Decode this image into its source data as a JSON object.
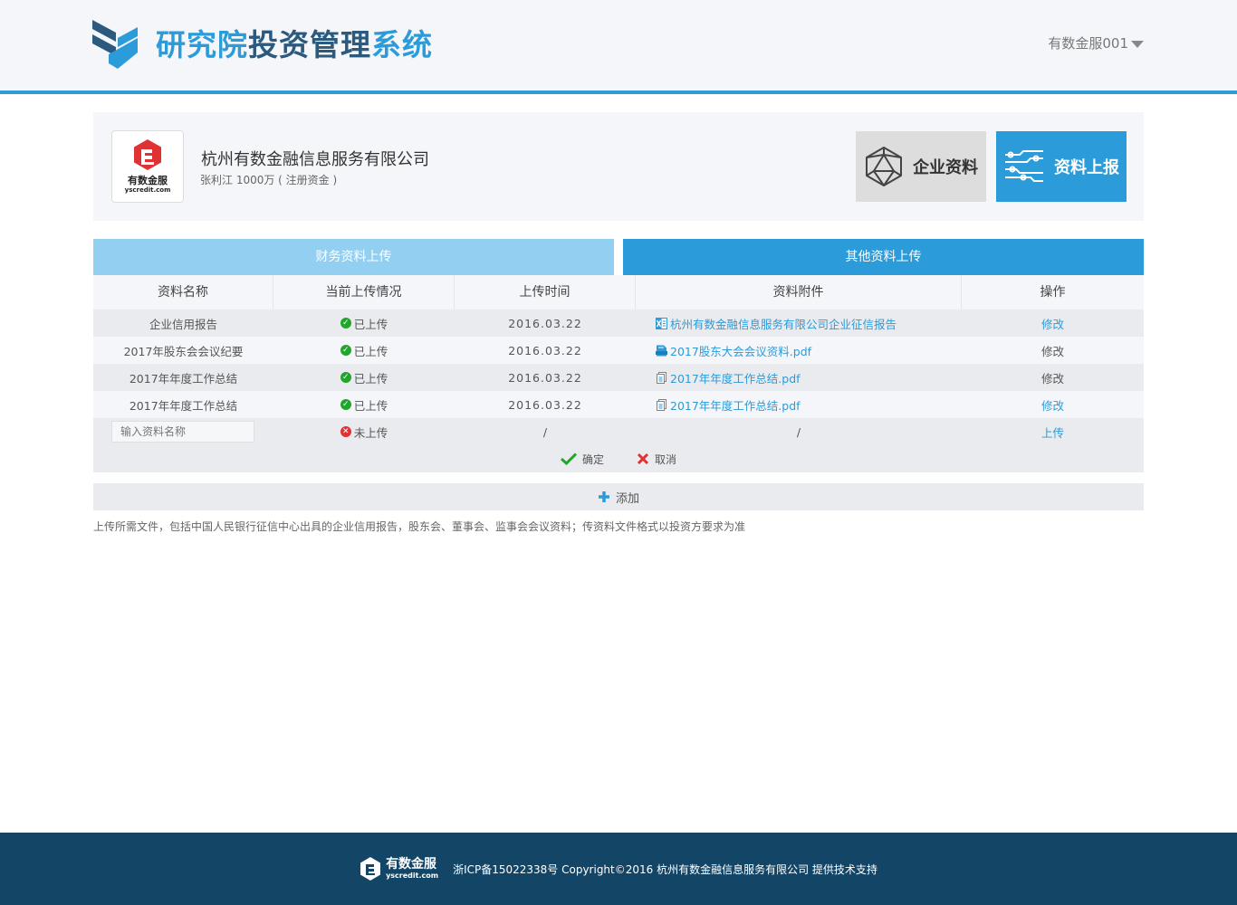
{
  "header": {
    "title_part1": "研究院",
    "title_part2": "投资管理",
    "title_part3": "系统",
    "user_name": "有数金服001"
  },
  "company": {
    "logo_name": "有数金服",
    "logo_domain": "yscredit.com",
    "name": "杭州有数金融信息服务有限公司",
    "info": "张利江 1000万 ( 注册资金 )",
    "tile_profile_label": "企业资料",
    "tile_report_label": "资料上报"
  },
  "tabs": {
    "financial": "财务资料上传",
    "other": "其他资料上传"
  },
  "table": {
    "headers": [
      "资料名称",
      "当前上传情况",
      "上传时间",
      "资料附件",
      "操作"
    ],
    "rows": [
      {
        "name": "企业信用报告",
        "status": "已上传",
        "time": "2016.03.22",
        "file": "杭州有数金融信息服务有限公司企业征信报告",
        "file_icon": "excel-file-icon",
        "action": "修改"
      },
      {
        "name": "2017年股东会会议纪要",
        "status": "已上传",
        "time": "2016.03.22",
        "file": "2017股东大会会议资料.pdf",
        "file_icon": "pdf-file-icon",
        "action": "修改"
      },
      {
        "name": "2017年年度工作总结",
        "status": "已上传",
        "time": "2016.03.22",
        "file": "2017年年度工作总结.pdf",
        "file_icon": "document-file-icon",
        "action": "修改"
      },
      {
        "name": "2017年年度工作总结",
        "status": "已上传",
        "time": "2016.03.22",
        "file": "2017年年度工作总结.pdf",
        "file_icon": "document-file-icon",
        "action": "修改"
      }
    ],
    "new_row": {
      "placeholder": "输入资料名称",
      "status": "未上传",
      "time": "/",
      "file": "/",
      "action": "上传"
    },
    "confirm_label": "确定",
    "cancel_label": "取消"
  },
  "add_label": "添加",
  "note": "上传所需文件，包括中国人民银行征信中心出具的企业信用报告，股东会、董事会、监事会会议资料；传资料文件格式以投资方要求为准",
  "footer": {
    "logo_name": "有数金服",
    "logo_domain": "yscredit.com",
    "copyright": "浙ICP备15022338号 Copyright©2016 杭州有数金融信息服务有限公司 提供技术支持"
  },
  "colors": {
    "accent": "#2b9bd9",
    "accent_light": "#93cff0",
    "footer_bg": "#134566",
    "success": "#22a52c",
    "danger": "#e03232"
  }
}
